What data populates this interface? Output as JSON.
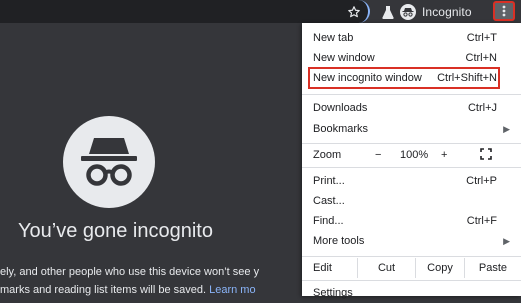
{
  "toolbar": {
    "profile_label": "Incognito"
  },
  "icons": {
    "bookmark": "star-icon",
    "extension": "flask-icon",
    "profile": "incognito-avatar-icon",
    "menu": "three-dots-vertical-icon",
    "hero": "incognito-hat-glasses-icon",
    "fullscreen": "fullscreen-icon"
  },
  "colors": {
    "page_bg": "#35363a",
    "omnibox_bg": "#202124",
    "accent_blue": "#8ab4f8",
    "highlight_red": "#d93025",
    "menu_bg": "#ffffff"
  },
  "page": {
    "headline": "You’ve gone incognito",
    "line1": "ely, and other people who use this device won’t see y",
    "line2_text": "marks and reading list items will be saved.",
    "line2_link": "Learn mo"
  },
  "menu": {
    "new_tab": {
      "label": "New tab",
      "shortcut": "Ctrl+T"
    },
    "new_window": {
      "label": "New window",
      "shortcut": "Ctrl+N"
    },
    "new_incognito": {
      "label": "New incognito window",
      "shortcut": "Ctrl+Shift+N"
    },
    "downloads": {
      "label": "Downloads",
      "shortcut": "Ctrl+J"
    },
    "bookmarks": {
      "label": "Bookmarks",
      "arrow": "▶"
    },
    "zoom": {
      "label": "Zoom",
      "minus": "−",
      "value": "100%",
      "plus": "+"
    },
    "print": {
      "label": "Print...",
      "shortcut": "Ctrl+P"
    },
    "cast": {
      "label": "Cast..."
    },
    "find": {
      "label": "Find...",
      "shortcut": "Ctrl+F"
    },
    "more_tools": {
      "label": "More tools",
      "arrow": "▶"
    },
    "edit": {
      "label": "Edit",
      "cut": "Cut",
      "copy": "Copy",
      "paste": "Paste"
    },
    "settings": {
      "label": "Settings"
    }
  }
}
